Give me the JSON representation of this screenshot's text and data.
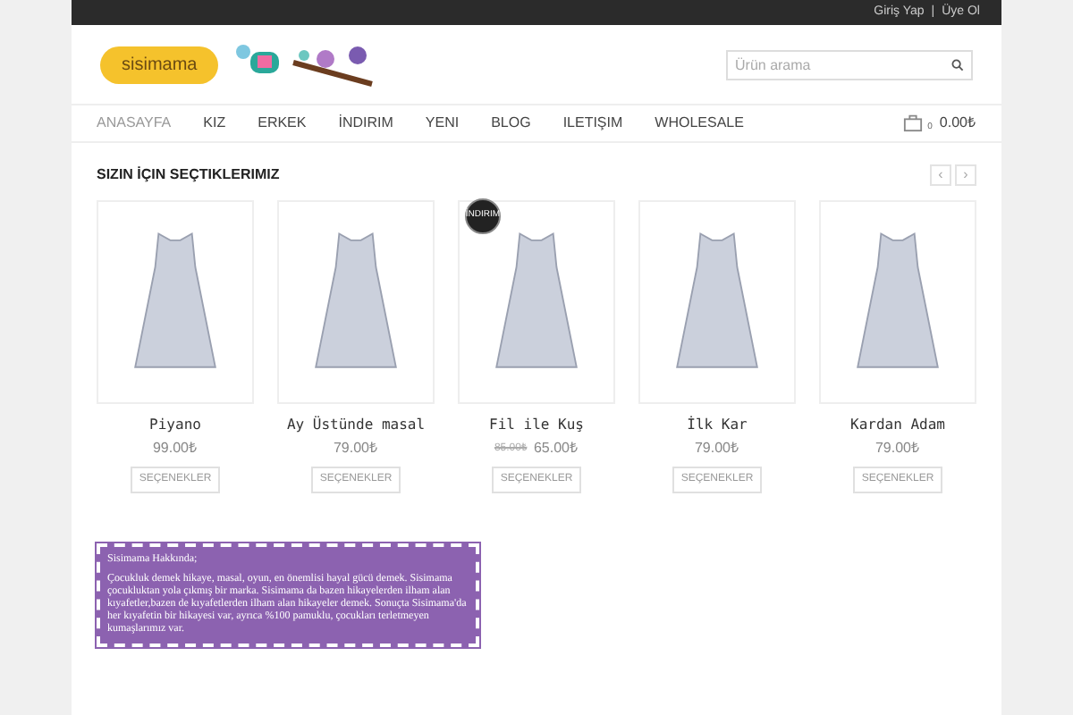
{
  "top_bar": {
    "login": "Giriş Yap",
    "separator": "|",
    "register": "Üye Ol"
  },
  "header": {
    "logo": "sisimama",
    "search": {
      "placeholder": "Ürün arama"
    }
  },
  "nav": [
    {
      "label": "ANASAYFA",
      "selected": true
    },
    {
      "label": "KIZ",
      "selected": false
    },
    {
      "label": "ERKEK",
      "selected": false
    },
    {
      "label": "İNDIRIM",
      "selected": false
    },
    {
      "label": "YENI",
      "selected": false
    },
    {
      "label": "BLOG",
      "selected": false
    },
    {
      "label": "ILETIŞIM",
      "selected": false
    },
    {
      "label": "WHOLESALE",
      "selected": false
    }
  ],
  "cart": {
    "count": "0",
    "total": "0.00₺"
  },
  "section": {
    "title": "SIZIN İÇIN SEÇTIKLERIMIZ",
    "prev": "‹",
    "next": "›"
  },
  "products": [
    {
      "name": "Piyano",
      "price": "99.00₺",
      "button": "SEÇENEKLER"
    },
    {
      "name": "Ay Üstünde masal",
      "price": "79.00₺",
      "button": "SEÇENEKLER"
    },
    {
      "name": "Fil ile Kuş",
      "old_price": "85.00₺",
      "price": "65.00₺",
      "badge": "İNDIRIM",
      "button": "SEÇENEKLER"
    },
    {
      "name": "İlk Kar",
      "price": "79.00₺",
      "button": "SEÇENEKLER"
    },
    {
      "name": "Kardan Adam",
      "price": "79.00₺",
      "button": "SEÇENEKLER"
    }
  ],
  "about": {
    "title": "Sisimama Hakkında;",
    "text": "Çocukluk demek hikaye, masal, oyun, en önemlisi hayal gücü demek. Sisimama çocukluktan yola çıkmış bir marka. Sisimama da bazen hikayelerden ilham alan kıyafetler,bazen de kıyafetlerden ilham alan hikayeler demek. Sonuçta Sisimama'da her kıyafetin bir hikayesi var, ayrıca %100 pamuklu, çocukları terletmeyen kumaşlarımız var."
  }
}
